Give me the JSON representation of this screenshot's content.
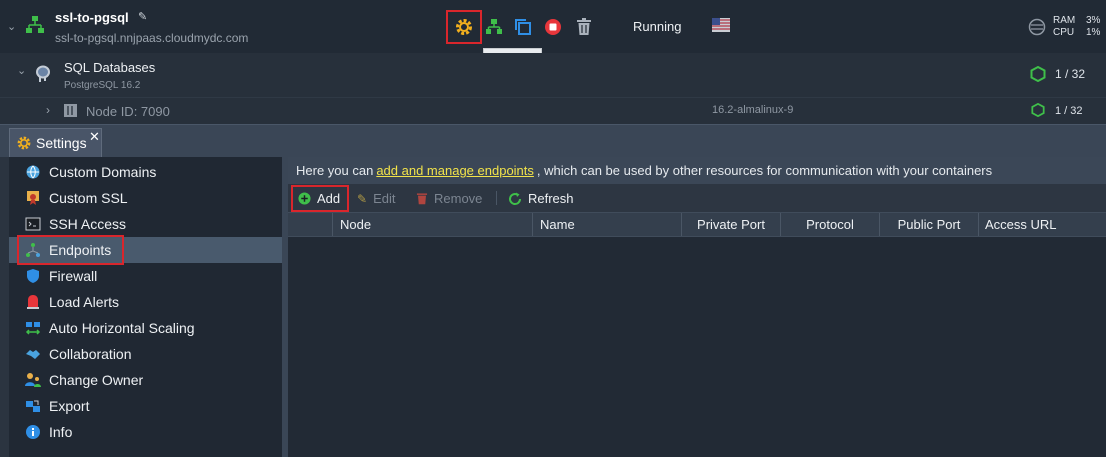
{
  "environment": {
    "name": "ssl-to-pgsql",
    "domain": "ssl-to-pgsql.nnjpaas.cloudmydc.com",
    "status": "Running",
    "ram_label": "RAM",
    "cpu_label": "CPU",
    "ram_value": "3%",
    "cpu_value": "1%"
  },
  "tooltip": "Settings",
  "database": {
    "title": "SQL Databases",
    "subtitle": "PostgreSQL 16.2",
    "count": "1 / 32"
  },
  "node": {
    "label": "Node ID: 7090",
    "tag": "16.2-almalinux-9",
    "count": "1 / 32"
  },
  "settings": {
    "tab_label": "Settings",
    "sidebar": [
      {
        "label": "Custom Domains",
        "icon": "custom-domains-icon"
      },
      {
        "label": "Custom SSL",
        "icon": "certificate-icon"
      },
      {
        "label": "SSH Access",
        "icon": "terminal-icon"
      },
      {
        "label": "Endpoints",
        "icon": "endpoints-icon"
      },
      {
        "label": "Firewall",
        "icon": "shield-icon"
      },
      {
        "label": "Load Alerts",
        "icon": "alert-icon"
      },
      {
        "label": "Auto Horizontal Scaling",
        "icon": "scaling-icon"
      },
      {
        "label": "Collaboration",
        "icon": "handshake-icon"
      },
      {
        "label": "Change Owner",
        "icon": "owner-icon"
      },
      {
        "label": "Export",
        "icon": "export-icon"
      },
      {
        "label": "Info",
        "icon": "info-icon"
      }
    ],
    "info": {
      "prefix": "Here you can",
      "link": "add and manage endpoints",
      "suffix": ", which can be used by other resources for communication with your containers"
    },
    "toolbar": {
      "add": "Add",
      "edit": "Edit",
      "remove": "Remove",
      "refresh": "Refresh"
    },
    "columns": [
      "Node",
      "Name",
      "Private Port",
      "Protocol",
      "Public Port",
      "Access URL"
    ]
  },
  "colors": {
    "accent_green": "#3fbf4a",
    "highlight_red": "#d9262c",
    "gear_yellow": "#f2b01e",
    "link_yellow": "#f2e34a"
  }
}
